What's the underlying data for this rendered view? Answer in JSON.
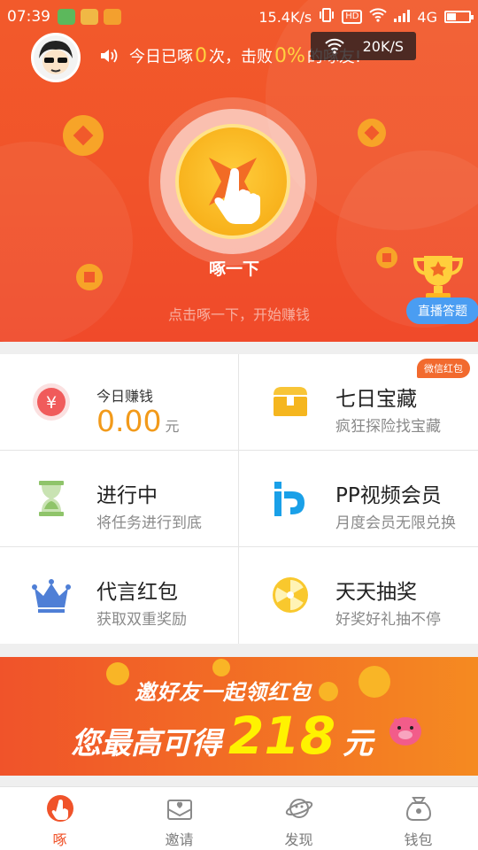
{
  "status_bar": {
    "time": "07:39",
    "net_speed": "15.4K/s",
    "network": "4G",
    "hd": "HD"
  },
  "speed_overlay": {
    "value": "20K/S"
  },
  "announcement": {
    "prefix": "今日已啄",
    "count": "0",
    "middle": "次，击败",
    "percent": "0%",
    "suffix": "的啄友!"
  },
  "peck_button": {
    "label": "啄一下",
    "hint": "点击啄一下，开始赚钱"
  },
  "live_quiz_button": {
    "label": "直播答题"
  },
  "grid": {
    "earnings": {
      "label": "今日赚钱",
      "amount": "0.00",
      "unit": "元"
    },
    "treasure": {
      "title": "七日宝藏",
      "subtitle": "疯狂探险找宝藏",
      "badge": "微信红包"
    },
    "in_progress": {
      "title": "进行中",
      "subtitle": "将任务进行到底"
    },
    "pp_video": {
      "title": "PP视频会员",
      "subtitle": "月度会员无限兑换"
    },
    "endorse": {
      "title": "代言红包",
      "subtitle": "获取双重奖励"
    },
    "lottery": {
      "title": "天天抽奖",
      "subtitle": "好奖好礼抽不停"
    }
  },
  "banner": {
    "line1": "邀好友一起领红包",
    "line2_prefix": "您最高可得",
    "amount": "218",
    "unit": "元"
  },
  "bottom_nav": {
    "active": "peck",
    "items": [
      {
        "id": "peck",
        "label": "啄"
      },
      {
        "id": "invite",
        "label": "邀请"
      },
      {
        "id": "discover",
        "label": "发现"
      },
      {
        "id": "wallet",
        "label": "钱包"
      }
    ]
  },
  "colors": {
    "hero_orange": "#f25a2b",
    "accent_yellow": "#ffd23f",
    "money_orange": "#f29a1a",
    "live_blue": "#4a9df2",
    "active_nav": "#f0532a"
  }
}
